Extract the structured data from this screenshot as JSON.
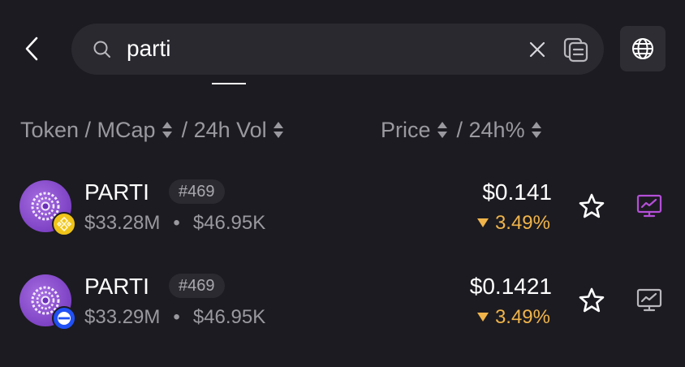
{
  "search": {
    "query": "parti"
  },
  "header": {
    "token_label": "Token / MCap",
    "vol_label": "/ 24h Vol",
    "price_label": "Price",
    "change_label": "/ 24h%"
  },
  "colors": {
    "background": "#1c1b21",
    "change_down": "#f0b44a",
    "chart_active": "#b44fd8",
    "chart_inactive": "#b9b8bd"
  },
  "tokens": [
    {
      "name": "PARTI",
      "rank": "#469",
      "mcap": "$33.28M",
      "vol": "$46.95K",
      "price": "$0.141",
      "change": "3.49%",
      "chain_icon": "bnb-chain-icon",
      "chart_active": true
    },
    {
      "name": "PARTI",
      "rank": "#469",
      "mcap": "$33.29M",
      "vol": "$46.95K",
      "price": "$0.1421",
      "change": "3.49%",
      "chain_icon": "base-chain-icon",
      "chart_active": false
    }
  ]
}
